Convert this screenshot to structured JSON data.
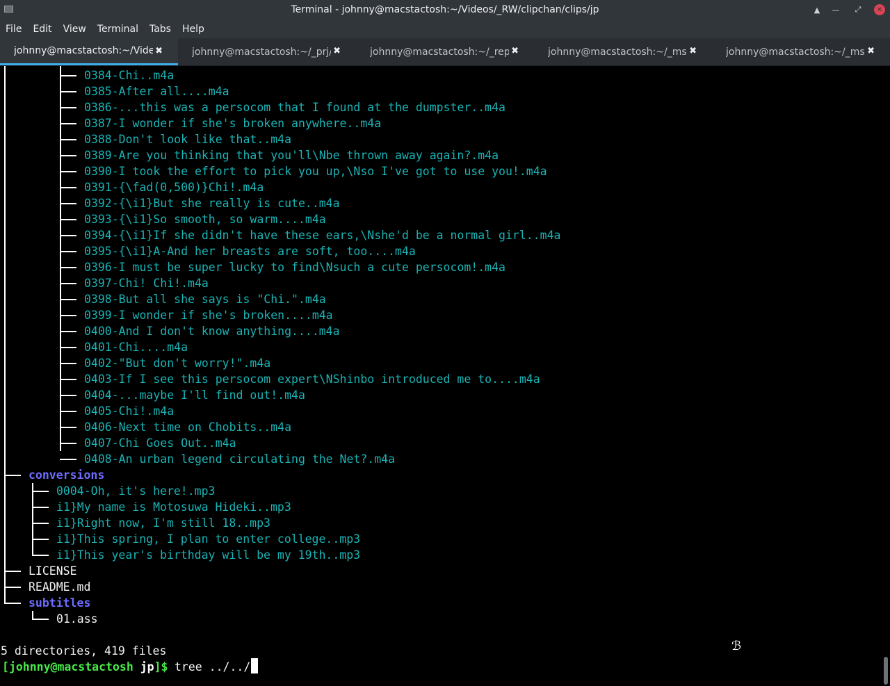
{
  "window": {
    "title": "Terminal - johnny@macstactosh:~/Videos/_RW/clipchan/clips/jp",
    "controls": [
      "keep-above",
      "minimize",
      "maximize",
      "close"
    ]
  },
  "menu": [
    "File",
    "Edit",
    "View",
    "Terminal",
    "Tabs",
    "Help"
  ],
  "tabs": [
    {
      "label": "johnny@macstactosh:~/Videos...",
      "active": true
    },
    {
      "label": "johnny@macstactosh:~/_prj/te...",
      "active": false
    },
    {
      "label": "johnny@macstactosh:~/_repo/...",
      "active": false
    },
    {
      "label": "johnny@macstactosh:~/_msc/_...",
      "active": false
    },
    {
      "label": "johnny@macstactosh:~/_msc/_...",
      "active": false
    }
  ],
  "terminal": {
    "clips": [
      "0384-Chi..m4a",
      "0385-After all....m4a",
      "0386-...this was a persocom that I found at the dumpster..m4a",
      "0387-I wonder if she's broken anywhere..m4a",
      "0388-Don't look like that..m4a",
      "0389-Are you thinking that you'll\\Nbe thrown away again?.m4a",
      "0390-I took the effort to pick you up,\\Nso I've got to use you!.m4a",
      "0391-{\\fad(0,500)}Chi!.m4a",
      "0392-{\\i1}But she really is cute..m4a",
      "0393-{\\i1}So smooth, so warm....m4a",
      "0394-{\\i1}If she didn't have these ears,\\Nshe'd be a normal girl..m4a",
      "0395-{\\i1}A-And her breasts are soft, too....m4a",
      "0396-I must be super lucky to find\\Nsuch a cute persocom!.m4a",
      "0397-Chi! Chi!.m4a",
      "0398-But all she says is \"Chi.\".m4a",
      "0399-I wonder if she's broken....m4a",
      "0400-And I don't know anything....m4a",
      "0401-Chi....m4a",
      "0402-\"But don't worry!\".m4a",
      "0403-If I see this persocom expert\\NShinbo introduced me to....m4a",
      "0404-...maybe I'll find out!.m4a",
      "0405-Chi!.m4a",
      "0406-Next time on Chobits..m4a",
      "0407-Chi Goes Out..m4a",
      "0408-An urban legend circulating the Net?.m4a"
    ],
    "conversions_dir": "conversions",
    "conversions": [
      "0004-Oh, it's here!.mp3",
      "i1}My name is Motosuwa Hideki..mp3",
      "i1}Right now, I'm still 18..mp3",
      "i1}This spring, I plan to enter college..mp3",
      "i1}This year's birthday will be my 19th..mp3"
    ],
    "license": "LICENSE",
    "readme": "README.md",
    "subtitles_dir": "subtitles",
    "subtitles": [
      "01.ass"
    ],
    "summary": "5 directories, 419 files",
    "prompt": {
      "open": "[",
      "userhost": "johnny@macstactosh",
      "cwd": "jp",
      "close": "]$",
      "command": "tree ../../"
    }
  },
  "colors": {
    "file": "#1ab3b5",
    "directory": "#6e6cff",
    "prompt": "#47e847",
    "tab_accent": "#3daee9",
    "close_button": "#da4453"
  }
}
